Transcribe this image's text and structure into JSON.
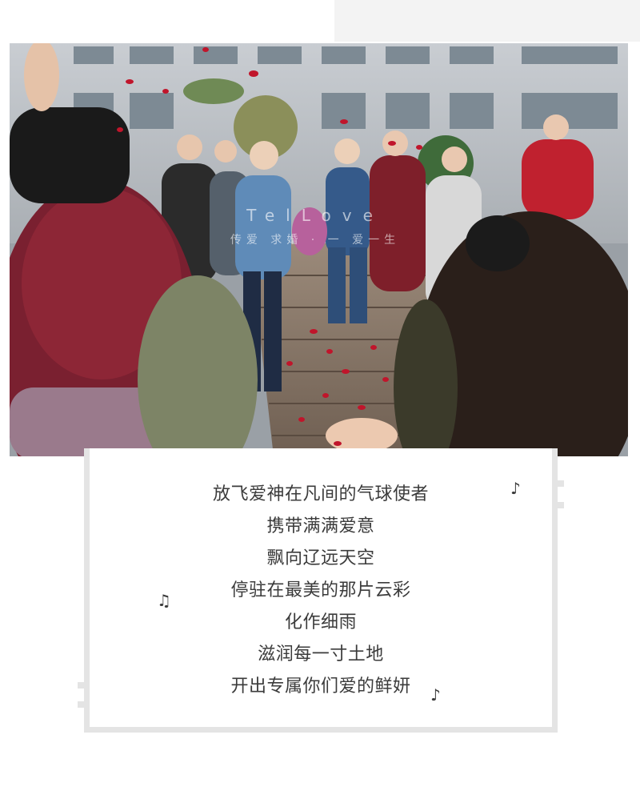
{
  "photo": {
    "watermark_top": "TelLove",
    "watermark_bottom": "传爱 求婚 · 一 爱一生"
  },
  "poem": {
    "lines": [
      "放飞爱神在凡间的气球使者",
      "携带满满爱意",
      "飘向辽远天空",
      "停驻在最美的那片云彩",
      "化作细雨",
      "滋润每一寸土地",
      "开出专属你们爱的鲜妍"
    ]
  },
  "icons": [
    "music-note-icon",
    "double-music-note-icon",
    "music-note-icon"
  ],
  "colors": {
    "frame": "#e4e4e4",
    "text": "#3b3b3b",
    "petal": "#c0152b"
  }
}
